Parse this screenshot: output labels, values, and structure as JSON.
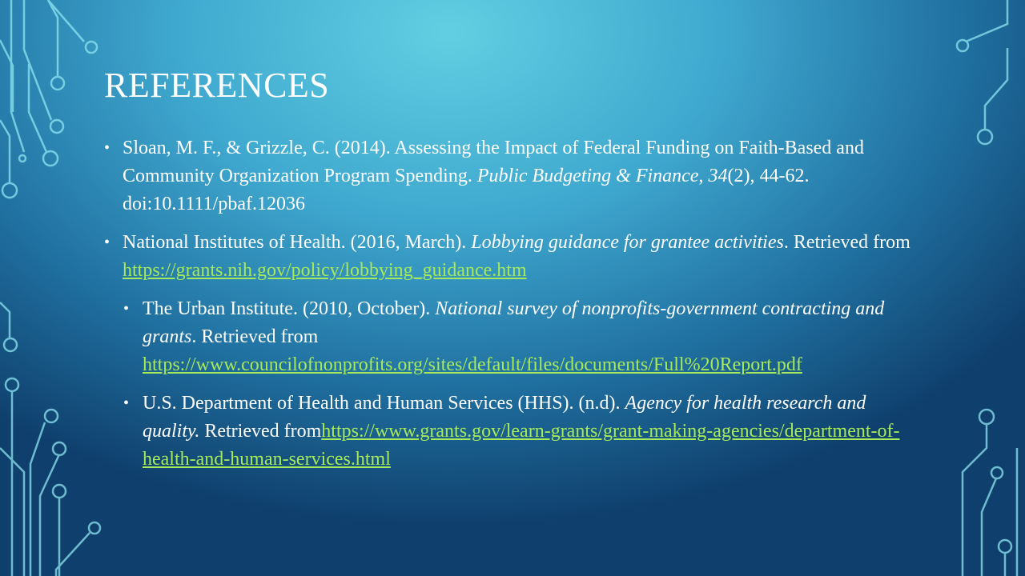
{
  "slide": {
    "title": "REFERENCES",
    "refs": [
      {
        "bullet": "•",
        "part1": "Sloan, M. F., & Grizzle, C. (2014). Assessing the Impact of Federal Funding on Faith-Based and Community Organization Program Spending. ",
        "journal": "Public Budgeting & Finance",
        "sep": ", ",
        "volume": "34",
        "part2": "(2), 44-62. doi:10.1111/pbaf.12036"
      },
      {
        "bullet": "•",
        "part1": "National Institutes of Health. (2016, March). ",
        "title_italic": "Lobbying guidance for grantee activities",
        "part2": ". Retrieved from ",
        "link": "https://grants.nih.gov/policy/lobbying_guidance.htm"
      },
      {
        "bullet": "•",
        "part1": "The Urban Institute. (2010, October). ",
        "title_italic": "National survey of nonprofits-government contracting and grants",
        "part2": ". Retrieved from ",
        "link": "https://www.councilofnonprofits.org/sites/default/files/documents/Full%20Report.pdf"
      },
      {
        "bullet": "•",
        "part1": "U.S. Department of Health and Human Services (HHS). (n.d). ",
        "title_italic": "Agency for health research and quality.",
        "part2": " Retrieved from",
        "link": "https://www.grants.gov/learn-grants/grant-making-agencies/department-of-health-and-human-services.html"
      }
    ]
  },
  "colors": {
    "link": "#a6e95a",
    "circuit": "#7fe3f0"
  }
}
